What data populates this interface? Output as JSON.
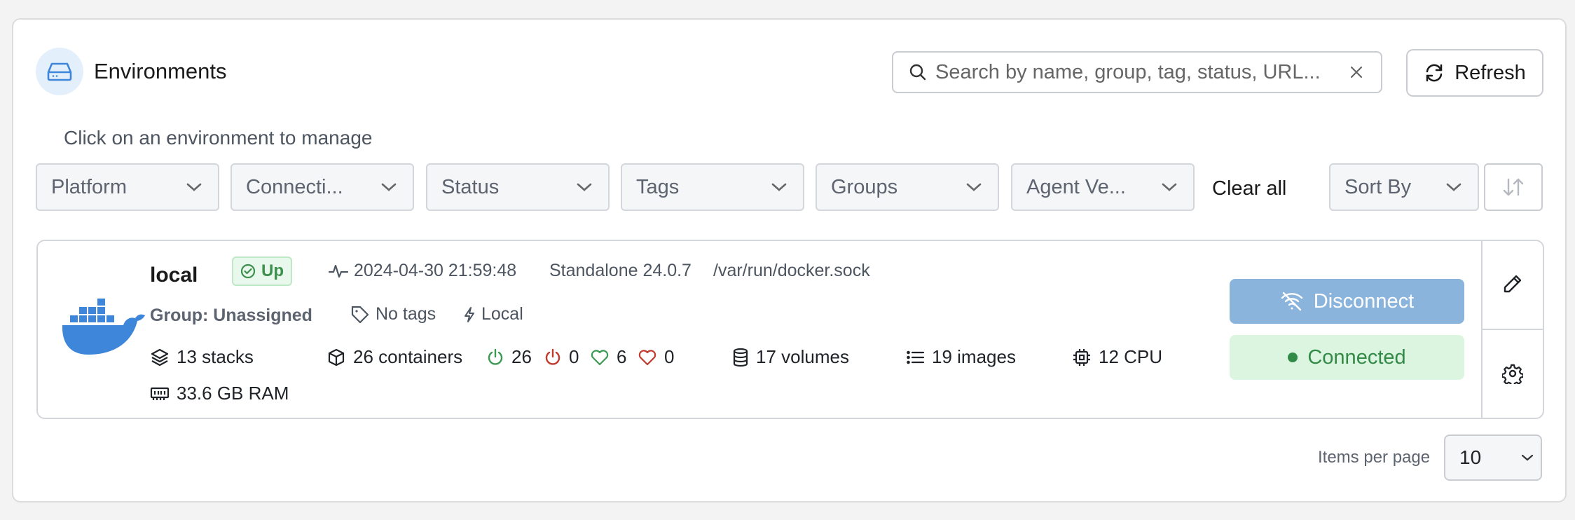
{
  "header": {
    "title": "Environments",
    "subtitle": "Click on an environment to manage",
    "search_placeholder": "Search by name, group, tag, status, URL...",
    "refresh_label": "Refresh"
  },
  "filters": [
    {
      "label": "Platform"
    },
    {
      "label": "Connecti..."
    },
    {
      "label": "Status"
    },
    {
      "label": "Tags"
    },
    {
      "label": "Groups"
    },
    {
      "label": "Agent Ve..."
    }
  ],
  "clear_all_label": "Clear all",
  "sort_by_label": "Sort By",
  "environment": {
    "name": "local",
    "status": "Up",
    "last_check": "2024-04-30 21:59:48",
    "type": "Standalone 24.0.7",
    "url": "/var/run/docker.sock",
    "group": "Group: Unassigned",
    "tags": "No tags",
    "kind": "Local",
    "stacks": "13 stacks",
    "containers": "26 containers",
    "running": "26",
    "stopped": "0",
    "healthy": "6",
    "unhealthy": "0",
    "volumes": "17 volumes",
    "images": "19 images",
    "cpu": "12 CPU",
    "ram": "33.6 GB RAM",
    "disconnect_label": "Disconnect",
    "connected_label": "Connected"
  },
  "pagination": {
    "items_per_page_label": "Items per page",
    "items_per_page_value": "10"
  },
  "colors": {
    "accent": "#3e86d9",
    "success": "#338a47",
    "danger": "#c0392b"
  }
}
